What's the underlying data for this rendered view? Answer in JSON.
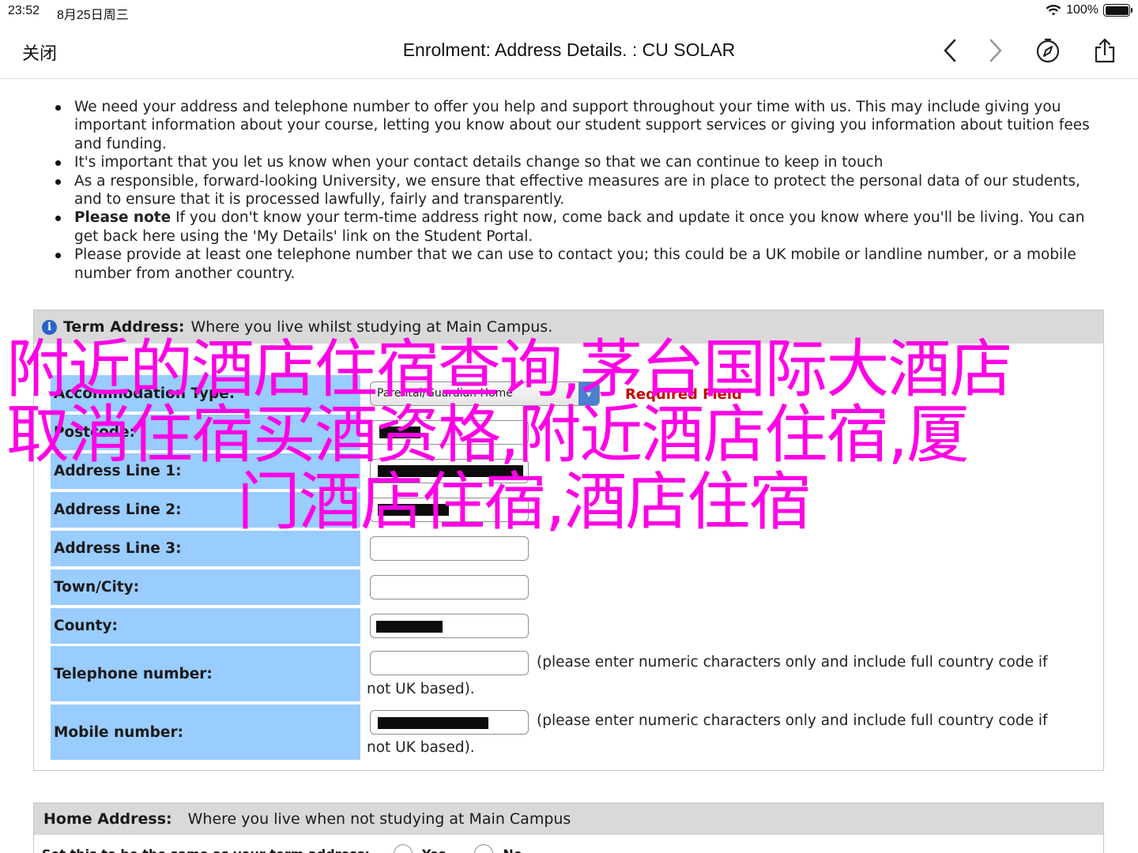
{
  "status_bar": {
    "time": "23:52",
    "date": "8月25日周三",
    "battery": "100%"
  },
  "nav": {
    "close_label": "关闭",
    "title": "Enrolment: Address Details. : CU SOLAR",
    "icons": [
      "chevron-left-icon",
      "chevron-right-icon",
      "compass-icon",
      "share-icon"
    ]
  },
  "intro_bullets": [
    {
      "bold": "",
      "text": "We need your address and telephone number to offer you help and support throughout your time with us. This may include giving you important information about your course, letting you know about our student support services or giving you information about tuition fees and funding."
    },
    {
      "bold": "",
      "text": "It's important that you let us know when your contact details change so that we can continue to keep in touch"
    },
    {
      "bold": "",
      "text": "As a responsible, forward-looking University, we ensure that effective measures are in place to protect the personal data of our students, and to ensure that it is processed lawfully, fairly and transparently."
    },
    {
      "bold": "Please note",
      "text": " If you don't know your term-time address right now, come back and update it once you know where you'll be living. You can get back here using the 'My Details' link on the Student Portal."
    },
    {
      "bold": "",
      "text": "Please provide at least one telephone number that we can use to contact you; this could be a UK mobile or landline number, or a mobile number from another country."
    }
  ],
  "term_address": {
    "heading": "Term Address:",
    "subheading": "Where you live whilst studying at Main Campus.",
    "accommodation_label": "Accommodation Type:",
    "accommodation_value": "Parental/Guardian Home",
    "required_label": "Required Field",
    "postcode_label": "Postcode:",
    "line1_label": "Address Line 1:",
    "line2_label": "Address Line 2:",
    "line3_label": "Address Line 3:",
    "town_label": "Town/City:",
    "county_label": "County:",
    "telephone_label": "Telephone number:",
    "mobile_label": "Mobile number:",
    "hint_line1": "(please enter numeric characters only and include full country code if",
    "hint_line2": "not UK based)."
  },
  "home_address": {
    "heading": "Home Address:",
    "subheading": "Where you live when not studying at Main Campus",
    "same_label": "Set this to be the same as your term address:",
    "yes_label": "Yes",
    "no_label": "No"
  },
  "overlay": {
    "line1": "附近的酒店住宿查询,茅台国际大酒店",
    "line2": "取消住宿买酒资格,附近酒店住宿,厦",
    "line3": "门酒店住宿,酒店住宿",
    "color": "#ff00e6"
  },
  "colors": {
    "label_bg": "#99ccff",
    "header_bg": "#d9d9d9",
    "required": "#cc0000"
  }
}
